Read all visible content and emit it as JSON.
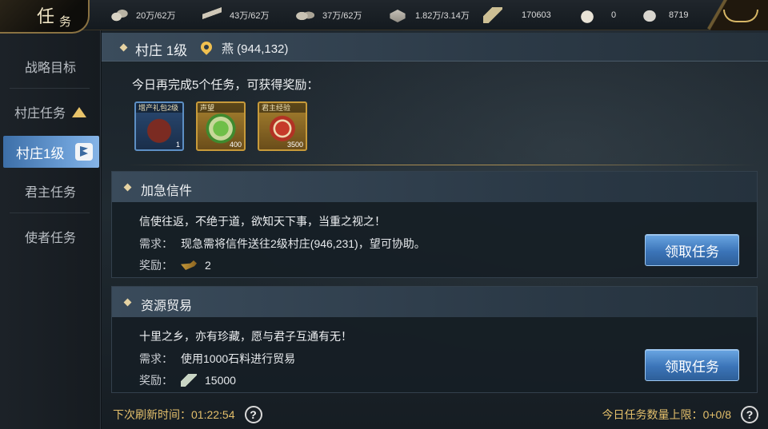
{
  "header": {
    "title_char1": "任",
    "title_char2": "务",
    "resources": [
      {
        "icon": "grain-icon",
        "value": "20万/62万"
      },
      {
        "icon": "wood-icon",
        "value": "43万/62万"
      },
      {
        "icon": "stone-icon",
        "value": "37万/62万"
      },
      {
        "icon": "iron-icon",
        "value": "1.82万/3.14万"
      },
      {
        "icon": "decree-icon",
        "value": "170603"
      },
      {
        "icon": "gold-ingot-icon",
        "value": "0"
      },
      {
        "icon": "silver-ingot-icon",
        "value": "8719"
      }
    ]
  },
  "sidebar": {
    "items": [
      {
        "label": "战略目标"
      },
      {
        "label": "村庄任务"
      },
      {
        "label": "村庄1级"
      },
      {
        "label": "君主任务"
      },
      {
        "label": "使者任务"
      }
    ]
  },
  "village": {
    "title": "村庄 1级",
    "location": "燕 (944,132)",
    "reward_prompt": "今日再完成5个任务，可获得奖励：",
    "rewards": [
      {
        "name": "增产礼包2级",
        "count": "1"
      },
      {
        "name": "声望",
        "count": "400"
      },
      {
        "name": "君主经验",
        "count": "3500"
      }
    ]
  },
  "quests": [
    {
      "title": "加急信件",
      "desc": "信使往返，不绝于道，欲知天下事，当重之视之！",
      "req_label": "需求：",
      "req": "现急需将信件送往2级村庄(946,231)，望可协助。",
      "reward_label": "奖励：",
      "reward": "2",
      "button": "领取任务"
    },
    {
      "title": "资源贸易",
      "desc": "十里之乡，亦有珍藏，愿与君子互通有无！",
      "req_label": "需求：",
      "req": "使用1000石料进行贸易",
      "reward_label": "奖励：",
      "reward": "15000",
      "button": "领取任务"
    }
  ],
  "footer": {
    "refresh_label": "下次刷新时间：",
    "refresh_time": "01:22:54",
    "limit_label": "今日任务数量上限：",
    "limit_value": "0+0/8",
    "help": "?"
  },
  "colors": {
    "accent_gold": "#e3bf6b",
    "button_blue": "#3b74b8",
    "selected_tab": "#6da0d8"
  }
}
